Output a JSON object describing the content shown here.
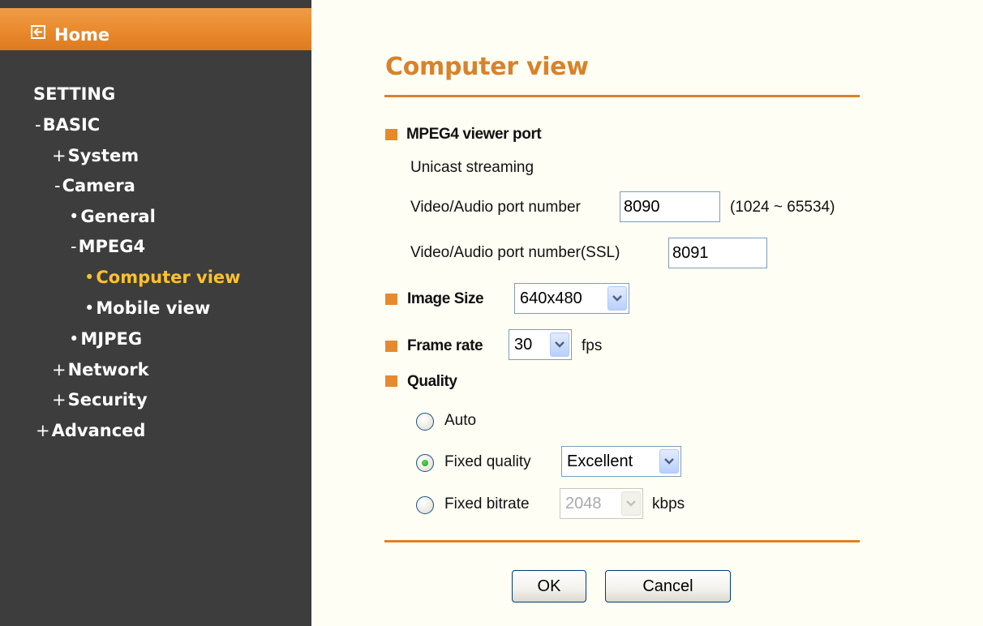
{
  "sidebar": {
    "home_label": "Home",
    "setting_label": "SETTING",
    "items": [
      {
        "marker": "-",
        "label": "BASIC"
      },
      {
        "marker": "+",
        "label": "System"
      },
      {
        "marker": "-",
        "label": "Camera"
      },
      {
        "marker": "•",
        "label": "General"
      },
      {
        "marker": "-",
        "label": "MPEG4"
      },
      {
        "marker": "•",
        "label": "Computer view",
        "active": true
      },
      {
        "marker": "•",
        "label": "Mobile view"
      },
      {
        "marker": "•",
        "label": "MJPEG"
      },
      {
        "marker": "+",
        "label": "Network"
      },
      {
        "marker": "+",
        "label": "Security"
      },
      {
        "marker": "+",
        "label": "Advanced"
      }
    ]
  },
  "main": {
    "title": "Computer view",
    "mpeg4_port": {
      "label": "MPEG4 viewer port",
      "unicast_label": "Unicast streaming",
      "port_label": "Video/Audio port number",
      "port_value": "8090",
      "port_range": "(1024 ~ 65534)",
      "ssl_port_label": "Video/Audio port number(SSL)",
      "ssl_port_value": "8091"
    },
    "image_size": {
      "label": "Image Size",
      "value": "640x480"
    },
    "frame_rate": {
      "label": "Frame rate",
      "value": "30",
      "unit": "fps"
    },
    "quality": {
      "label": "Quality",
      "options": [
        {
          "label": "Auto",
          "selected": false
        },
        {
          "label": "Fixed quality",
          "selected": true,
          "select_value": "Excellent"
        },
        {
          "label": "Fixed bitrate",
          "selected": false,
          "select_value": "2048",
          "unit": "kbps",
          "disabled": true
        }
      ]
    },
    "buttons": {
      "ok": "OK",
      "cancel": "Cancel"
    }
  },
  "colors": {
    "sidebar_bg": "#3d3d3d",
    "home_bar": "#e98a2c",
    "accent": "#d9822b",
    "active_nav": "#ffc12e",
    "page_bg": "#fffef4"
  },
  "icons": {
    "home": "back-arrow-box-icon",
    "dropdown": "chevron-down-icon",
    "bullet": "square-bullet-icon"
  }
}
